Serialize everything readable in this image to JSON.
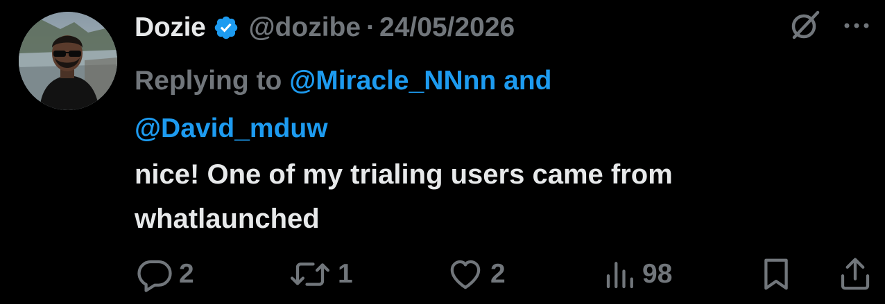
{
  "tweet": {
    "author_name": "Dozie",
    "handle": "@dozibe",
    "separator": "·",
    "date": "24/05/2026",
    "replying_prefix": "Replying to",
    "mention_1": "@Miracle_NNnn",
    "conjunction": "and",
    "mention_2": "@David_mduw",
    "text_line_1": "nice! One of my trialing users came from",
    "text_line_2": "whatlaunched"
  },
  "actions": {
    "replies": "2",
    "reposts": "1",
    "likes": "2",
    "views": "98"
  },
  "icons": {
    "verified": "verified-badge-icon",
    "grok": "grok-icon",
    "more": "more-dots-icon",
    "reply": "reply-bubble-icon",
    "repost": "repost-arrows-icon",
    "like": "heart-icon",
    "views": "analytics-bars-icon",
    "bookmark": "bookmark-icon",
    "share": "share-upload-icon"
  },
  "colors": {
    "background": "#000000",
    "text_primary": "#e7e9ea",
    "text_secondary": "#71767b",
    "accent": "#1d9bf0"
  }
}
